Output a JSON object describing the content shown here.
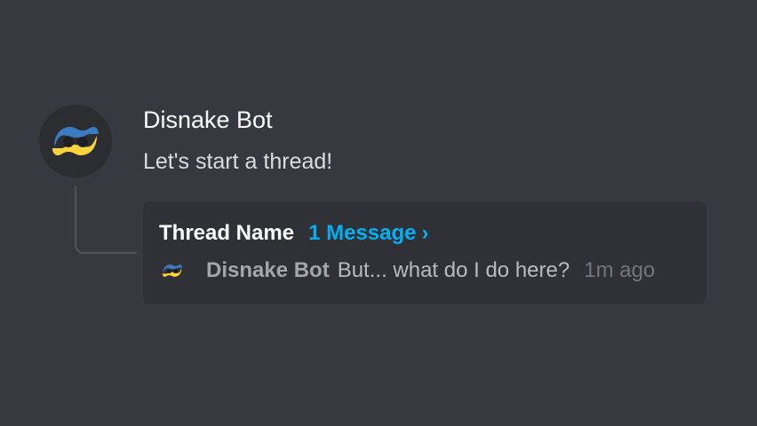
{
  "message": {
    "author": "Disnake Bot",
    "content": "Let's start a thread!",
    "avatar_icon": "disnake-logo-icon"
  },
  "thread": {
    "name": "Thread Name",
    "count_label": "1 Message",
    "chevron": "›",
    "preview": {
      "author": "Disnake Bot",
      "text": "But... what do I do here?",
      "time": "1m ago"
    }
  },
  "colors": {
    "background": "#36393f",
    "card": "#2f3136",
    "link": "#00aff4",
    "logo_blue": "#3b7bbf",
    "logo_yellow": "#ffd43b"
  }
}
